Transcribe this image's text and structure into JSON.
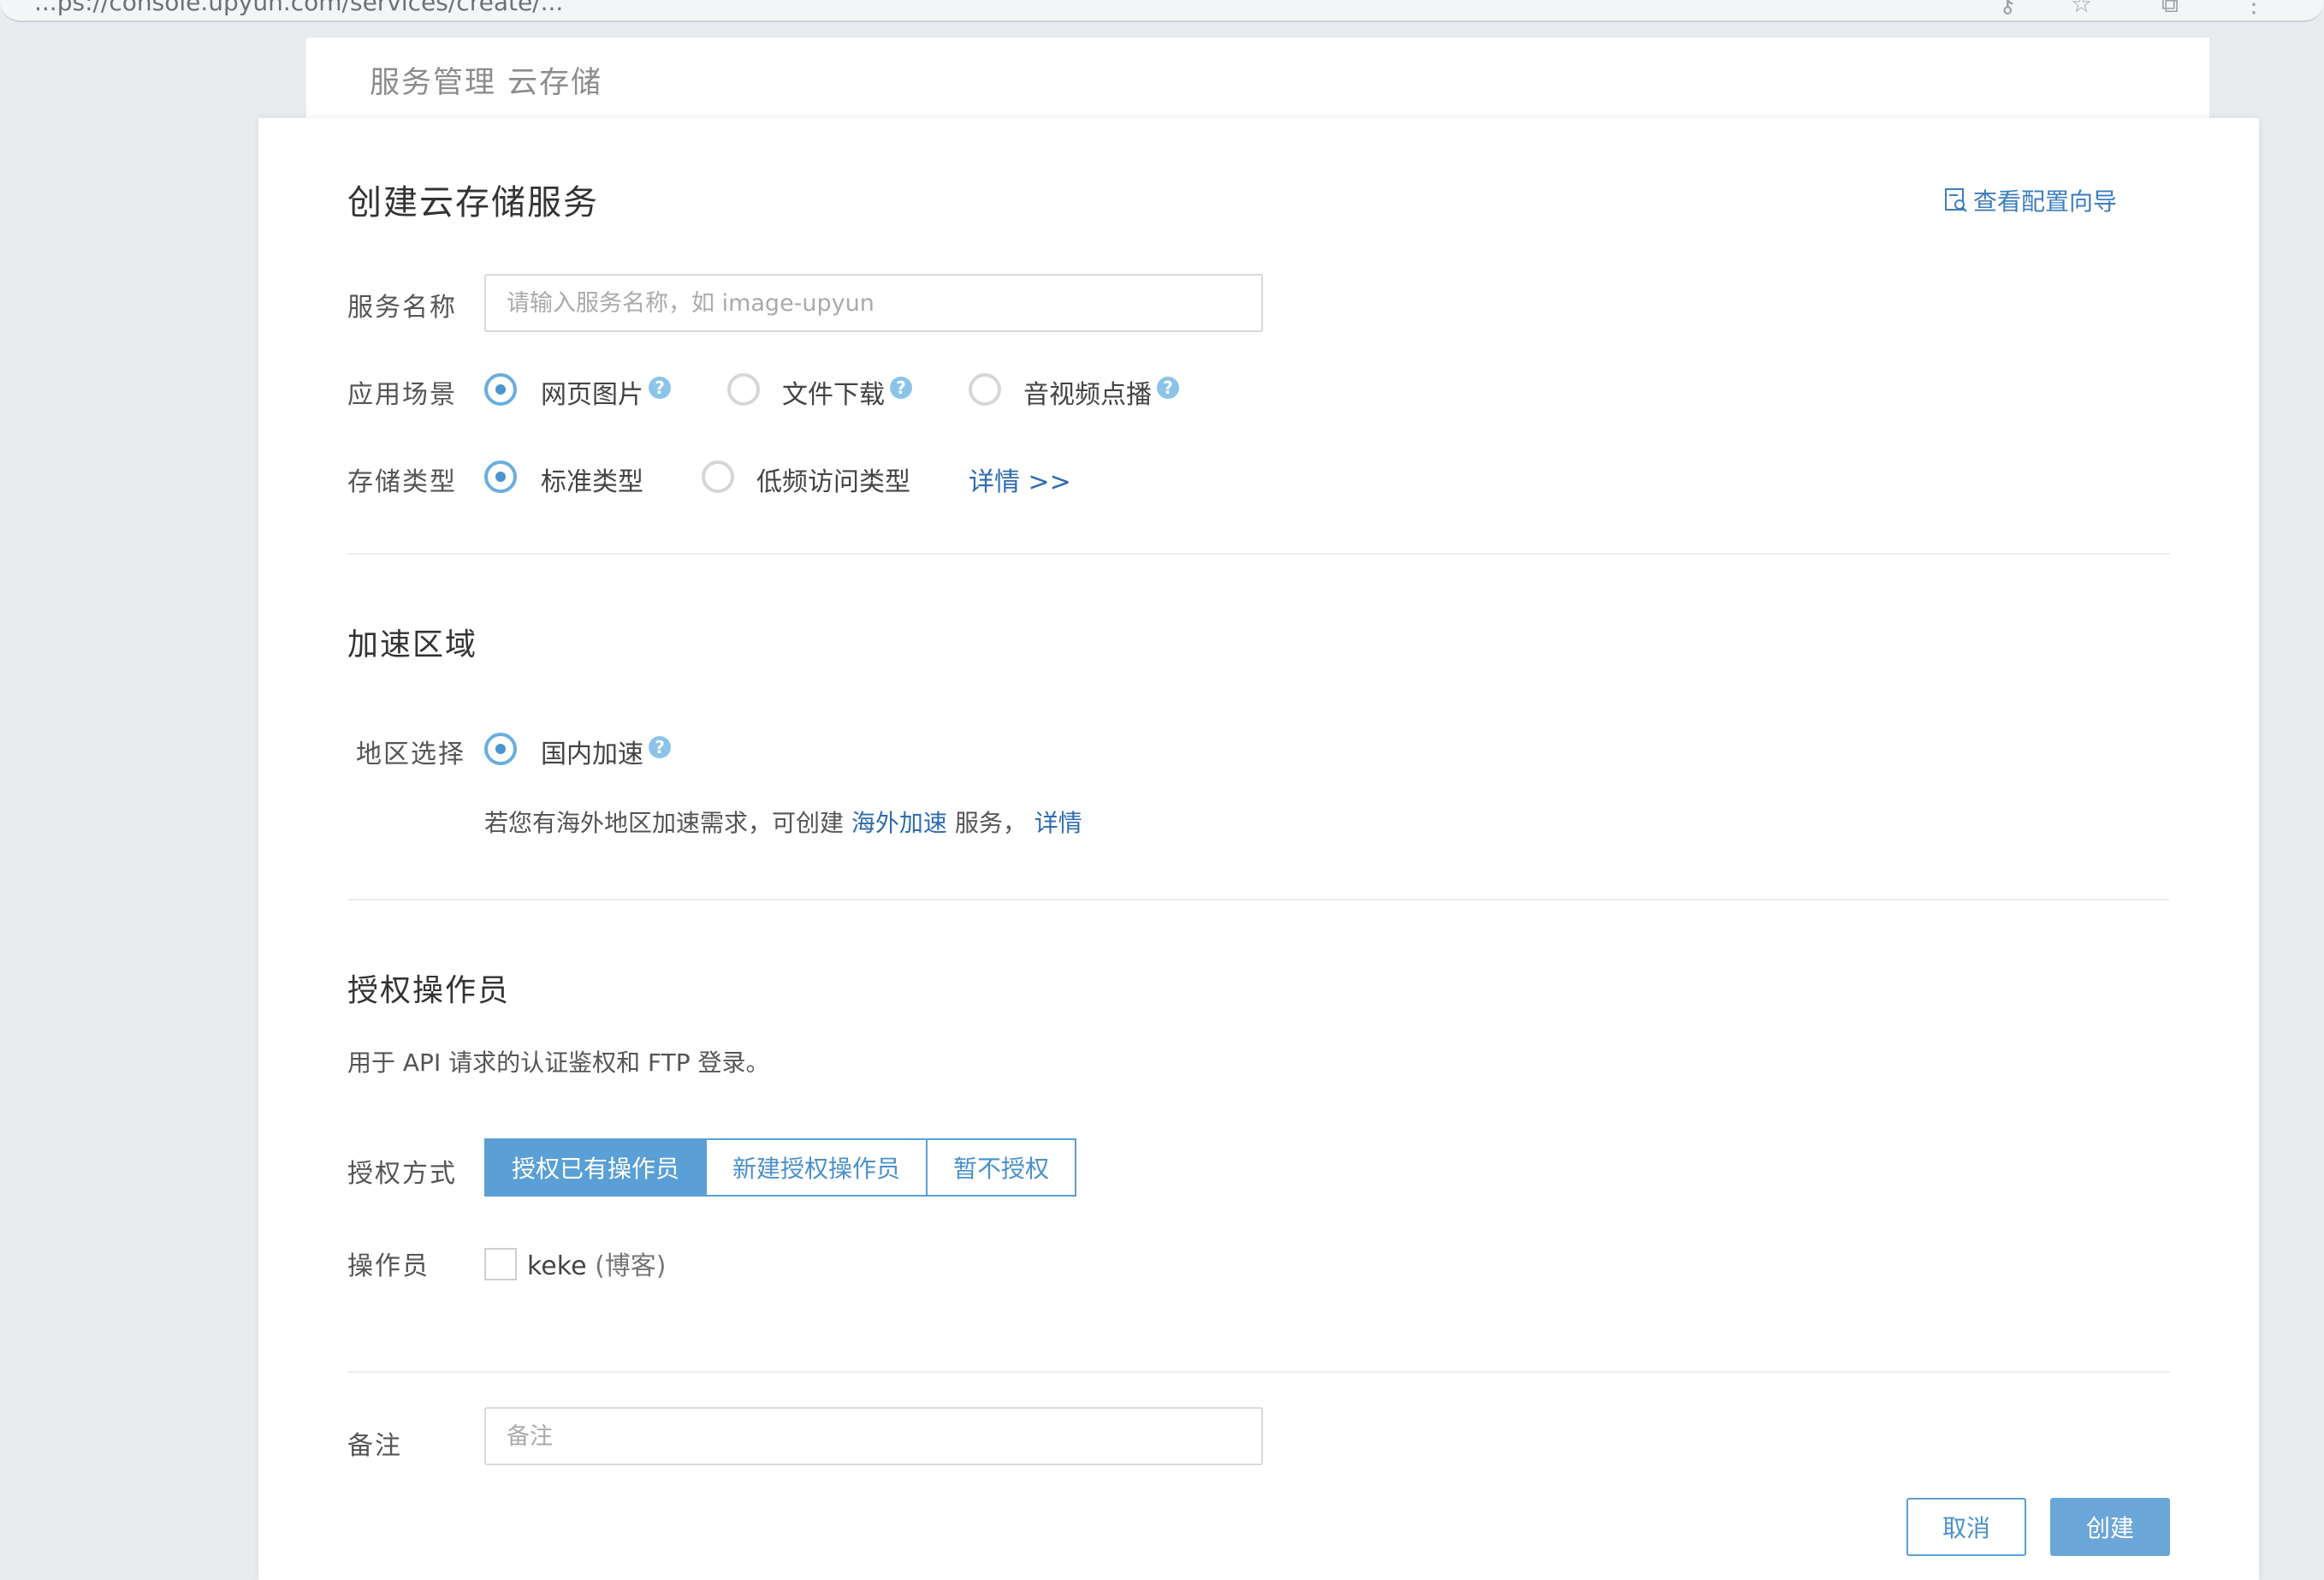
{
  "browser": {
    "url_fragment": "...ps://console.upyun.com/services/create/...",
    "icons": [
      "key-icon",
      "star-icon",
      "extensions-icon",
      "menu-icon"
    ]
  },
  "background_page": {
    "title": "服务管理 云存储"
  },
  "modal": {
    "title": "创建云存储服务",
    "guide_link": "查看配置向导",
    "service_name": {
      "label": "服务名称",
      "placeholder": "请输入服务名称，如 image-upyun",
      "value": ""
    },
    "scenario": {
      "label": "应用场景",
      "options": [
        {
          "label": "网页图片",
          "checked": true
        },
        {
          "label": "文件下载",
          "checked": false
        },
        {
          "label": "音视频点播",
          "checked": false
        }
      ]
    },
    "storage_type": {
      "label": "存储类型",
      "options": [
        {
          "label": "标准类型",
          "checked": true
        },
        {
          "label": "低频访问类型",
          "checked": false
        }
      ],
      "details_link": "详情 >>"
    },
    "acceleration": {
      "title": "加速区域",
      "region_label": "地区选择",
      "region_option": "国内加速",
      "note_prefix": "若您有海外地区加速需求，可创建",
      "note_link": "海外加速",
      "note_middle": "服务，",
      "note_details": "详情"
    },
    "operators": {
      "title": "授权操作员",
      "description": "用于 API 请求的认证鉴权和 FTP 登录。",
      "auth_label": "授权方式",
      "auth_options": [
        "授权已有操作员",
        "新建授权操作员",
        "暂不授权"
      ],
      "auth_selected": "授权已有操作员",
      "operator_label": "操作员",
      "operator_name": "keke",
      "operator_note": "(博客)",
      "operator_checked": false
    },
    "remark": {
      "label": "备注",
      "placeholder": "备注",
      "value": ""
    },
    "buttons": {
      "cancel": "取消",
      "create": "创建"
    }
  },
  "colors": {
    "accent": "#5a9fd6",
    "link": "#2f6db0",
    "primary_button": "#6aa6d8",
    "background": "#e9ecef"
  }
}
